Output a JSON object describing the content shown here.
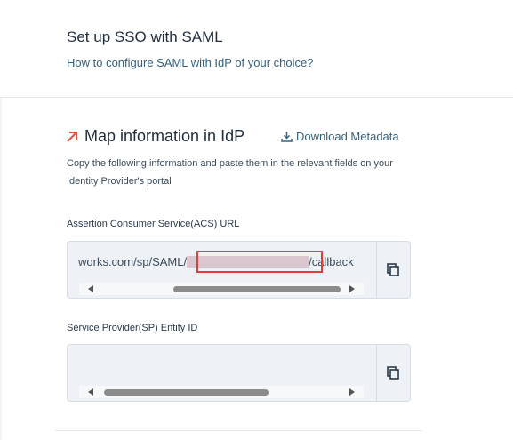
{
  "header": {
    "title": "Set up SSO with SAML",
    "subtitle": "How to configure SAML with IdP of your choice?"
  },
  "section": {
    "icon": "arrow-up-right-icon",
    "title": "Map information in IdP",
    "download_label": "Download Metadata",
    "download_icon": "download-icon",
    "description": "Copy the following information and paste them in the relevant fields on your Identity Provider's portal"
  },
  "acs": {
    "label": "Assertion Consumer Service(ACS) URL",
    "value_prefix": "works.com/sp/SAML/",
    "value_suffix": "/callback",
    "copy_icon": "copy-icon"
  },
  "sp": {
    "label": "Service Provider(SP) Entity ID",
    "value": "",
    "copy_icon": "copy-icon"
  },
  "colors": {
    "accent_arrow": "#e5533c",
    "link": "#36607e",
    "highlight": "#e53b3b",
    "field_bg": "#eef1f5"
  }
}
